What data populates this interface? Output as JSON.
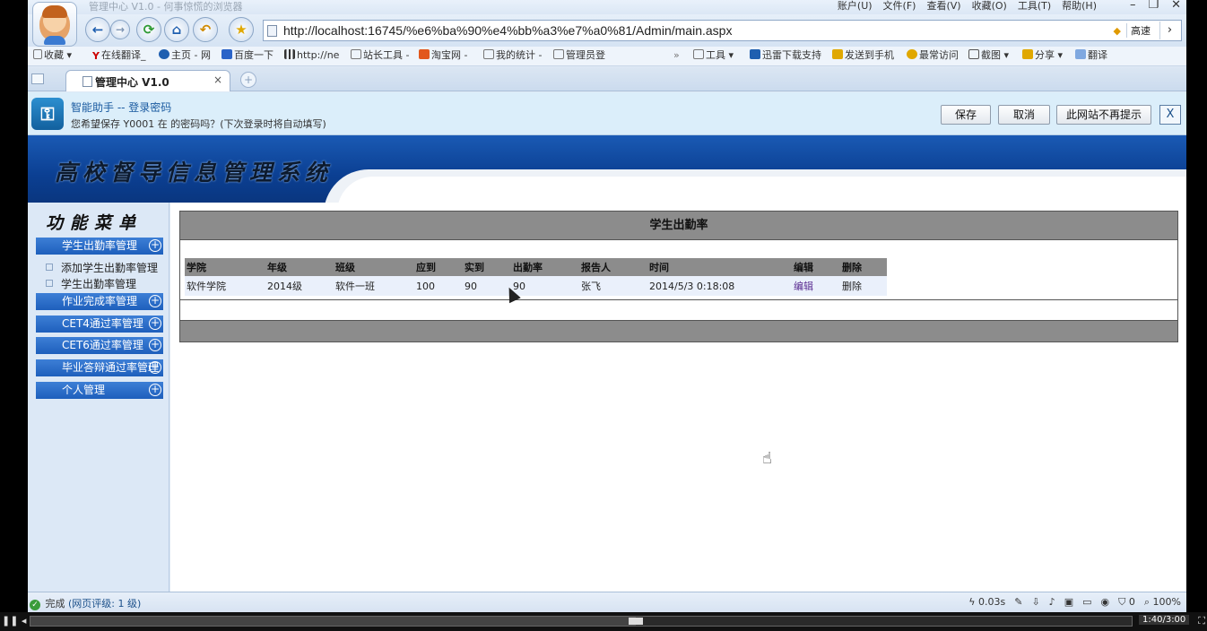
{
  "window": {
    "title": "管理中心 V1.0 - 何事惊慌的浏览器",
    "menus": [
      "账户(U)",
      "文件(F)",
      "查看(V)",
      "收藏(O)",
      "工具(T)",
      "帮助(H)"
    ],
    "controls": [
      "–",
      "❐",
      "✕"
    ]
  },
  "nav": {
    "url": "http://localhost:16745/%e6%ba%90%e4%bb%a3%e7%a0%81/Admin/main.aspx",
    "speed_label": "高速",
    "go": "›"
  },
  "bookmarks": [
    "收藏",
    "在线翻译_",
    "主页 - 网",
    "百度一下",
    "http://ne",
    "站长工具 -",
    "淘宝网 -",
    "我的统计 -",
    "管理员登",
    "»",
    "工具",
    "迅雷下载支持",
    "发送到手机",
    "最常访问",
    "截图",
    "分享",
    "翻译"
  ],
  "tab": {
    "label": "管理中心 V1.0",
    "close": "×",
    "new": "+"
  },
  "password_bar": {
    "title": "智能助手 -- 登录密码",
    "message": "您希望保存 Y0001 在  的密码吗？(下次登录时将自动填写)",
    "save": "保存",
    "cancel": "取消",
    "never": "此网站不再提示",
    "close": "X"
  },
  "banner": {
    "system_name": "高校督导信息管理系统"
  },
  "sidebar": {
    "title": "功能菜单",
    "groups": [
      {
        "label": "学生出勤率管理",
        "items": [
          "添加学生出勤率管理",
          "学生出勤率管理"
        ]
      },
      {
        "label": "作业完成率管理"
      },
      {
        "label": "CET4通过率管理"
      },
      {
        "label": "CET6通过率管理"
      },
      {
        "label": "毕业答辩通过率管理"
      },
      {
        "label": "个人管理"
      }
    ]
  },
  "panel": {
    "title": "学生出勤率",
    "columns": [
      "学院",
      "年级",
      "班级",
      "应到",
      "实到",
      "出勤率",
      "报告人",
      "时间",
      "编辑",
      "删除"
    ],
    "rows": [
      [
        "软件学院",
        "2014级",
        "软件一班",
        "100",
        "90",
        "90",
        "张飞",
        "2014/5/3 0:18:08",
        "编辑",
        "删除"
      ]
    ]
  },
  "status": {
    "done": "完成",
    "rating": "(网页评级: 1 级)",
    "time": "0.03s",
    "count": "0",
    "zoom": "100%"
  },
  "player": {
    "time": "1:40/3:00",
    "progress": 0.55
  }
}
